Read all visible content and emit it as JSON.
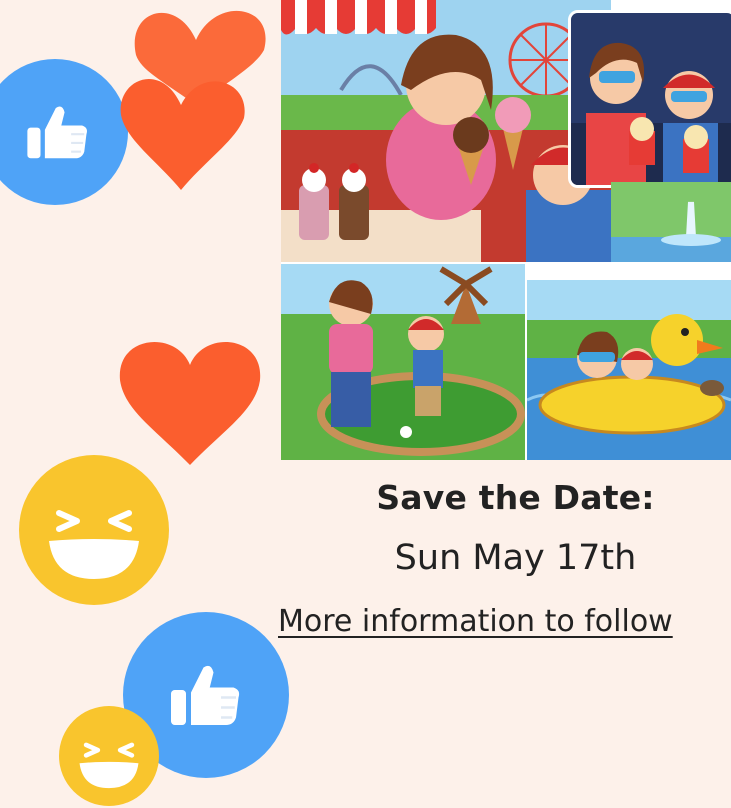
{
  "event": {
    "heading": "Save the Date:",
    "date": "Sun May 17th",
    "more_info_link": "More information to follow"
  },
  "decorations": {
    "icons": [
      "thumbs-up-icon",
      "heart-icon",
      "laughing-face-icon"
    ]
  },
  "colors": {
    "background": "#fdf1ea",
    "like_blue": "#4fa3f7",
    "heart_orange": "#fb5e2e",
    "laugh_yellow": "#f9c52d",
    "text": "#222222"
  }
}
